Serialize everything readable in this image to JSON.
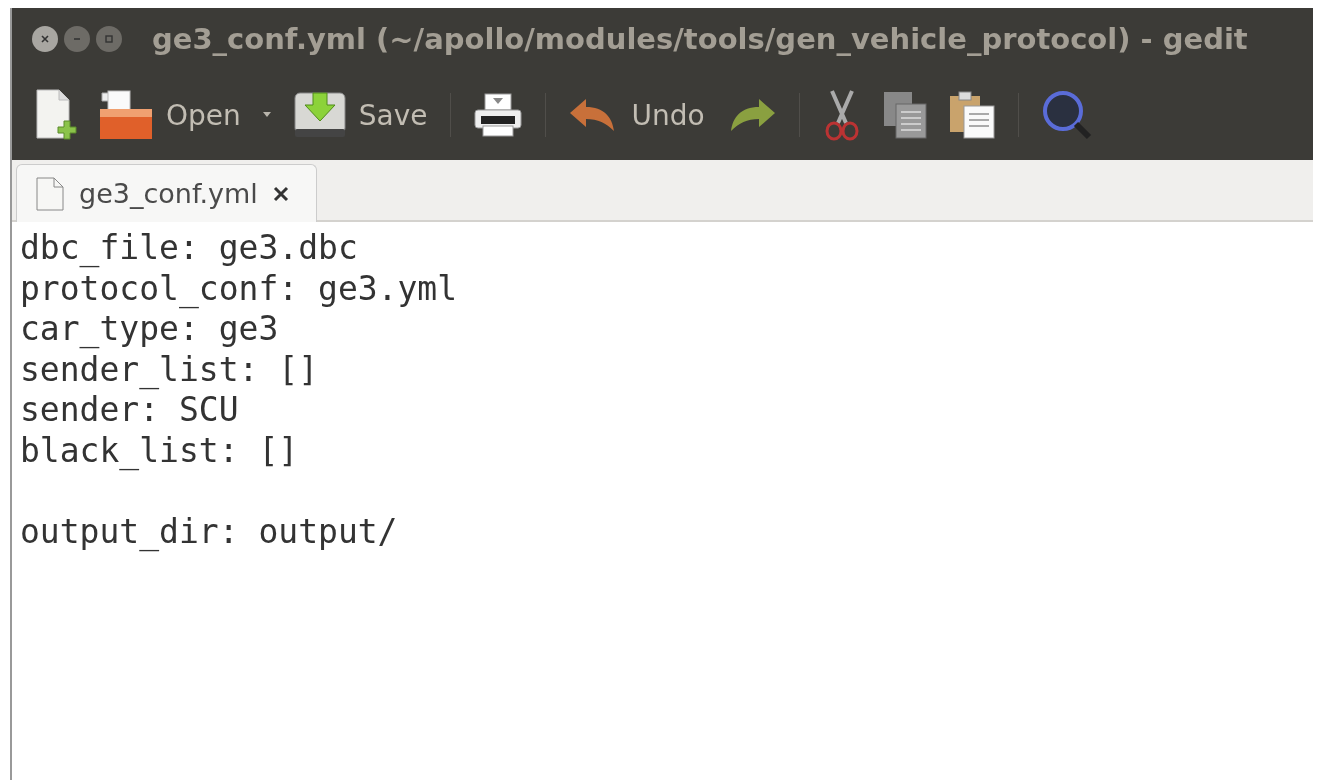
{
  "window": {
    "title": "ge3_conf.yml (~/apollo/modules/tools/gen_vehicle_protocol) - gedit"
  },
  "toolbar": [
    {
      "kind": "new"
    },
    {
      "kind": "open",
      "label": "Open"
    },
    {
      "kind": "dropdown"
    },
    {
      "kind": "save",
      "label": "Save"
    },
    {
      "kind": "separator"
    },
    {
      "kind": "print"
    },
    {
      "kind": "separator"
    },
    {
      "kind": "undo",
      "label": "Undo"
    },
    {
      "kind": "redo"
    },
    {
      "kind": "separator"
    },
    {
      "kind": "cut"
    },
    {
      "kind": "copy"
    },
    {
      "kind": "paste"
    },
    {
      "kind": "separator"
    },
    {
      "kind": "search"
    }
  ],
  "tabs": [
    {
      "label": "ge3_conf.yml",
      "selected": true
    }
  ],
  "editor": {
    "blocks": [
      [
        "dbc_file: ge3.dbc",
        "protocol_conf: ge3.yml",
        "car_type: ge3",
        "sender_list: []",
        "sender: SCU",
        "black_list: []"
      ],
      [
        "output_dir: output/"
      ]
    ]
  }
}
